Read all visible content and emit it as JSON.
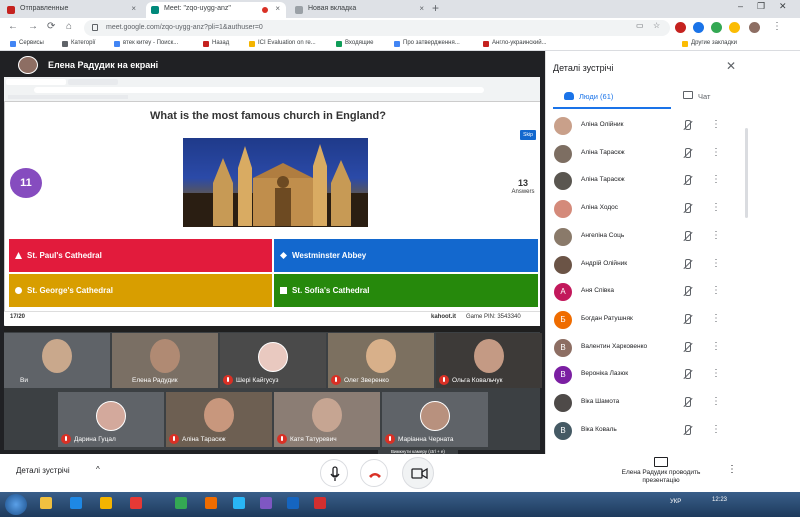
{
  "browser": {
    "tabs": [
      {
        "label": "Отправленные",
        "active": false,
        "color": "#c5221f"
      },
      {
        "label": "Meet: \"zqo-uygg-anz\"",
        "active": true,
        "color": "#00897b"
      },
      {
        "label": "Новая вкладка",
        "active": false,
        "color": "#9aa0a6"
      }
    ],
    "new_tab": "+",
    "url": "meet.google.com/zqo-uygg-anz?pli=1&authuser=0",
    "bookmarks": [
      {
        "label": "Сервисы",
        "color": "#4285f4"
      },
      {
        "label": "Категорії",
        "color": "#5f6368"
      },
      {
        "label": "втек китеу - Поиск...",
        "color": "#4285f4"
      },
      {
        "label": "Назад",
        "color": "#c5221f"
      },
      {
        "label": "ICI Evaluation on re...",
        "color": "#f4b400"
      },
      {
        "label": "Входящие",
        "color": "#0f9d58"
      },
      {
        "label": "Про затвердження...",
        "color": "#4285f4"
      },
      {
        "label": "Англо-украинский...",
        "color": "#c5221f"
      }
    ],
    "other_bookmarks": "Другие закладки"
  },
  "presentation": {
    "title": "Елена Радудик на екрані",
    "question": "What is the most famous church in England?",
    "timer": "11",
    "answers_count": "13",
    "answers_label": "Answers",
    "skip_label": "Skip",
    "answers": [
      {
        "label": "St. Paul's Cathedral",
        "color": "#e21b3c",
        "shape": "triangle"
      },
      {
        "label": "Westminster Abbey",
        "color": "#1368ce",
        "shape": "diamond"
      },
      {
        "label": "St. George's Cathedral",
        "color": "#d89e00",
        "shape": "circle"
      },
      {
        "label": "St. Sofia's Cathedral",
        "color": "#26890c",
        "shape": "square"
      }
    ],
    "progress": "17/20",
    "site": "kahoot.it",
    "game_pin": "Game PIN: 3543340"
  },
  "participants_tiles": [
    {
      "name": "Ви",
      "muted": false,
      "face": "#c9a88c",
      "bg": "#6b6b6b"
    },
    {
      "name": "Елена Радудик",
      "muted": false,
      "face": "#b08a73",
      "bg": "#7a6f64"
    },
    {
      "name": "Шері Кайгусуз",
      "muted": true,
      "face": "#e9c9c0",
      "bg": "#4a4a4a"
    },
    {
      "name": "Олег Зверенко",
      "muted": true,
      "face": "#d8b08a",
      "bg": "#7c7060"
    },
    {
      "name": "Ольга Ковальчук",
      "muted": true,
      "face": "#c49a84",
      "bg": "#3d3a38"
    },
    {
      "name": "Дарина Гуцал",
      "muted": true,
      "face": "#d3a99c",
      "bg": "#5f6368"
    },
    {
      "name": "Аліна Тараскж",
      "muted": true,
      "face": "#c8977d",
      "bg": "#6d5f52"
    },
    {
      "name": "Катя Татуревич",
      "muted": true,
      "face": "#c6a592",
      "bg": "#8b7d74"
    },
    {
      "name": "Маріанна Черната",
      "muted": true,
      "face": "#b8917e",
      "bg": "#5f6368"
    }
  ],
  "tooltip": "Вимкнути камеру (ctrl + e)",
  "bottom_bar": {
    "details_label": "Деталі зустрічі",
    "chevron": "^",
    "presenter_label": "Елена Радудик проводить презентацію",
    "more": "⋮"
  },
  "panel": {
    "title": "Деталі зустрічі",
    "close": "✕",
    "people_tab": "Люди (61)",
    "chat_tab": "Чат",
    "people": [
      {
        "name": "Аліна Олійник",
        "avatar": "photo",
        "color": "#c9a08a",
        "initial": ""
      },
      {
        "name": "Аліна Тараскж",
        "avatar": "photo",
        "color": "#7d6e62",
        "initial": ""
      },
      {
        "name": "Аліна Тараскж",
        "avatar": "photo",
        "color": "#5a5650",
        "initial": ""
      },
      {
        "name": "Аліна Ходос",
        "avatar": "photo",
        "color": "#d48a7a",
        "initial": ""
      },
      {
        "name": "Ангеліна Соць",
        "avatar": "photo",
        "color": "#8a7a6a",
        "initial": ""
      },
      {
        "name": "Андрій Олійник",
        "avatar": "photo",
        "color": "#6b5446",
        "initial": ""
      },
      {
        "name": "Аня Співка",
        "avatar": "letter",
        "color": "#c2185b",
        "initial": "А"
      },
      {
        "name": "Богдан Ратушняк",
        "avatar": "letter",
        "color": "#ef6c00",
        "initial": "Б"
      },
      {
        "name": "Валентин Харковенко",
        "avatar": "letter",
        "color": "#8d6e63",
        "initial": "В"
      },
      {
        "name": "Вероніка Лазюк",
        "avatar": "letter",
        "color": "#7b1fa2",
        "initial": "В"
      },
      {
        "name": "Віка Шамота",
        "avatar": "photo",
        "color": "#4e4a48",
        "initial": ""
      },
      {
        "name": "Віка Коваль",
        "avatar": "letter",
        "color": "#455a64",
        "initial": "В"
      }
    ]
  },
  "taskbar": {
    "lang": "УКР",
    "time": "12:23"
  }
}
